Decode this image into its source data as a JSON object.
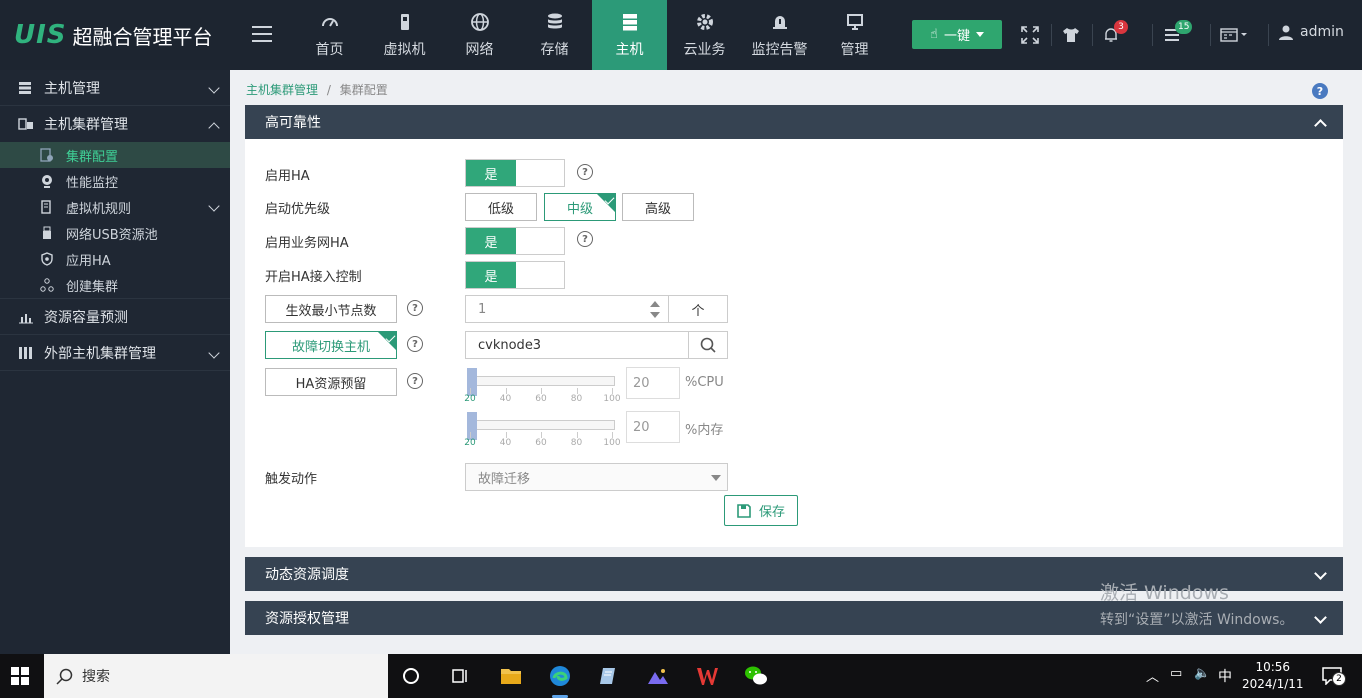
{
  "app": {
    "logo_mark": "UIS",
    "title": "超融合管理平台"
  },
  "nav": [
    {
      "label": "首页",
      "icon": "dashboard-icon"
    },
    {
      "label": "虚拟机",
      "icon": "vm-icon"
    },
    {
      "label": "网络",
      "icon": "globe-icon"
    },
    {
      "label": "存储",
      "icon": "database-icon"
    },
    {
      "label": "主机",
      "icon": "server-icon",
      "active": true
    },
    {
      "label": "云业务",
      "icon": "gear-icon"
    },
    {
      "label": "监控告警",
      "icon": "bell-alert-icon"
    },
    {
      "label": "管理",
      "icon": "monitor-icon"
    }
  ],
  "toolbar": {
    "onekey_label": "一键",
    "alerts_count": "3",
    "tasks_count": "15",
    "user": "admin"
  },
  "sidebar": {
    "host_mgmt": "主机管理",
    "cluster_mgmt": "主机集群管理",
    "sub": [
      "集群配置",
      "性能监控",
      "虚拟机规则",
      "网络USB资源池",
      "应用HA",
      "创建集群"
    ],
    "capacity": "资源容量预测",
    "external": "外部主机集群管理"
  },
  "breadcrumb": {
    "parent": "主机集群管理",
    "sep": "/",
    "current": "集群配置"
  },
  "help": "?",
  "ha_panel": {
    "title": "高可靠性",
    "enable_ha_label": "启用HA",
    "enable_ha_value": "是",
    "priority_label": "启动优先级",
    "priority_options": [
      "低级",
      "中级",
      "高级"
    ],
    "priority_selected": "中级",
    "biz_ha_label": "启用业务网HA",
    "biz_ha_value": "是",
    "admission_label": "开启HA接入控制",
    "admission_value": "是",
    "min_nodes_label": "生效最小节点数",
    "min_nodes_value": "1",
    "min_nodes_unit": "个",
    "failover_label": "故障切换主机",
    "failover_value": "cvknode3",
    "reserve_label": "HA资源预留",
    "cpu_value": "20",
    "cpu_unit": "%CPU",
    "mem_value": "20",
    "mem_unit": "%内存",
    "slider_ticks": [
      "20",
      "40",
      "60",
      "80",
      "100"
    ],
    "trigger_label": "触发动作",
    "trigger_value": "故障迁移",
    "save_label": "保存"
  },
  "drs_panel": {
    "title": "动态资源调度"
  },
  "license_panel": {
    "title": "资源授权管理"
  },
  "watermark": {
    "line1": "激活 Windows",
    "line2": "转到“设置”以激活 Windows。"
  },
  "taskbar": {
    "search_placeholder": "搜索",
    "ime": "中",
    "time": "10:56",
    "date": "2024/1/11",
    "notif_count": "2"
  }
}
